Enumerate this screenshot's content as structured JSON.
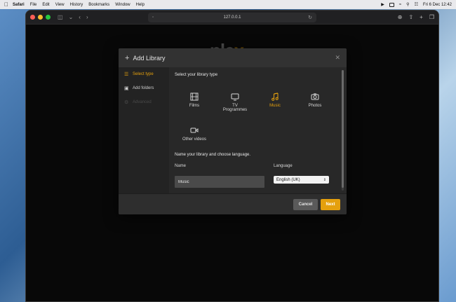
{
  "menubar": {
    "app": "Safari",
    "items": [
      "File",
      "Edit",
      "View",
      "History",
      "Bookmarks",
      "Window",
      "Help"
    ],
    "clock": "Fri 6 Dec  12:42"
  },
  "browser": {
    "address": "127.0.0.1"
  },
  "page": {
    "logo_main": "ple",
    "logo_x": "x"
  },
  "modal": {
    "title": "Add Library",
    "sidebar": [
      {
        "label": "Select type",
        "state": "active",
        "icon": "library-icon"
      },
      {
        "label": "Add folders",
        "state": "normal",
        "icon": "folder-icon"
      },
      {
        "label": "Advanced",
        "state": "disabled",
        "icon": "gear-icon"
      }
    ],
    "select_type_label": "Select your library type",
    "types": [
      {
        "label": "Films",
        "icon": "film-icon"
      },
      {
        "label": "TV Programmes",
        "icon": "tv-icon"
      },
      {
        "label": "Music",
        "icon": "music-icon",
        "selected": true
      },
      {
        "label": "Photos",
        "icon": "camera-icon"
      },
      {
        "label": "Other videos",
        "icon": "video-camera-icon"
      }
    ],
    "name_section_label": "Name your library and choose language.",
    "name_label": "Name",
    "name_value": "Music",
    "language_label": "Language",
    "language_value": "English (UK)",
    "cancel_label": "Cancel",
    "next_label": "Next"
  },
  "colors": {
    "accent": "#e5a00d",
    "modal_bg": "#282828",
    "sidebar_bg": "#232323"
  }
}
